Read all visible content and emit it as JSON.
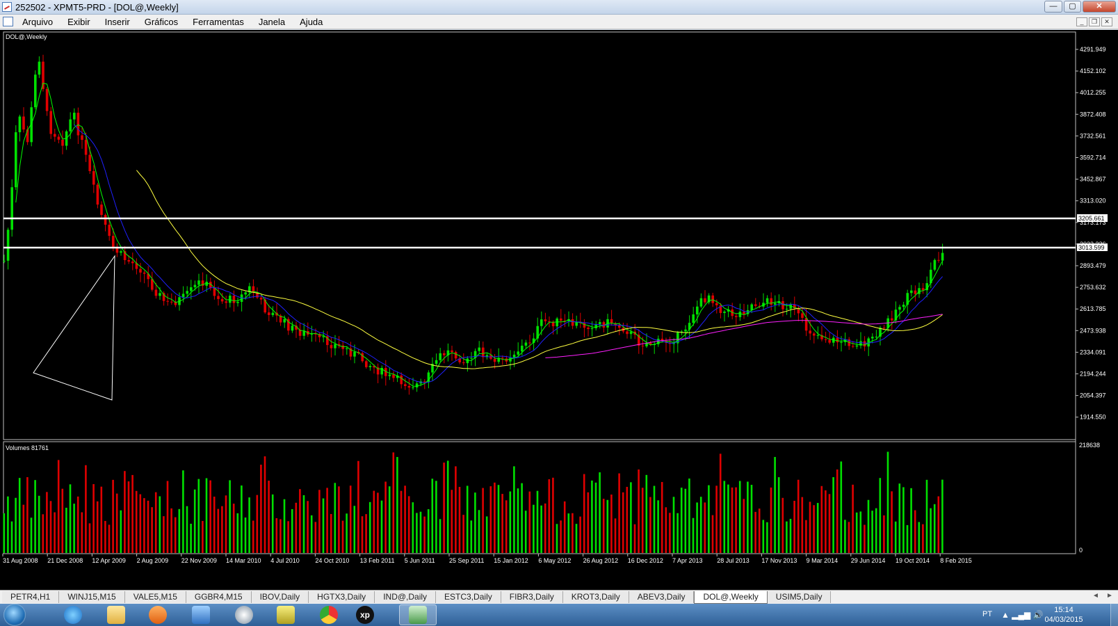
{
  "window": {
    "title": "252502 - XPMT5-PRD - [DOL@,Weekly]",
    "min_label": "—",
    "max_label": "▢",
    "close_label": "✕"
  },
  "menu": {
    "items": [
      "Arquivo",
      "Exibir",
      "Inserir",
      "Gráficos",
      "Ferramentas",
      "Janela",
      "Ajuda"
    ],
    "mdi_min": "_",
    "mdi_restore": "❐",
    "mdi_close": "✕"
  },
  "chart": {
    "symbol_label": "DOL@,Weekly",
    "volume_label": "Volumes 81761",
    "price_axis": [
      "4291.949",
      "4152.102",
      "4012.255",
      "3872.408",
      "3732.561",
      "3592.714",
      "3452.867",
      "3313.020",
      "3173.173",
      "3033.326",
      "2893.479",
      "2753.632",
      "2613.785",
      "2473.938",
      "2334.091",
      "2194.244",
      "2054.397",
      "1914.550"
    ],
    "hline_labels": [
      "3205.661",
      "3013.599"
    ],
    "volume_axis": [
      "218638",
      "0"
    ],
    "date_axis": [
      "31 Aug 2008",
      "21 Dec 2008",
      "12 Apr 2009",
      "2 Aug 2009",
      "22 Nov 2009",
      "14 Mar 2010",
      "4 Jul 2010",
      "24 Oct 2010",
      "13 Feb 2011",
      "5 Jun 2011",
      "25 Sep 2011",
      "15 Jan 2012",
      "6 May 2012",
      "26 Aug 2012",
      "16 Dec 2012",
      "7 Apr 2013",
      "28 Jul 2013",
      "17 Nov 2013",
      "9 Mar 2014",
      "29 Jun 2014",
      "19 Oct 2014",
      "8 Feb 2015"
    ],
    "colors": {
      "background": "#000000",
      "bull": "#00e000",
      "bear": "#e00000",
      "ma_fast": "#00ff00",
      "ma_mid": "#2020ff",
      "ma_slow": "#ffff40",
      "ma_long": "#ff20ff",
      "hline": "#ffffff"
    }
  },
  "tabs": {
    "items": [
      "PETR4,H1",
      "WINJ15,M15",
      "VALE5,M15",
      "GGBR4,M15",
      "IBOV,Daily",
      "HGTX3,Daily",
      "IND@,Daily",
      "ESTC3,Daily",
      "FIBR3,Daily",
      "KROT3,Daily",
      "ABEV3,Daily",
      "DOL@,Weekly",
      "USIM5,Daily"
    ],
    "active": "DOL@,Weekly",
    "scroll_left": "◄",
    "scroll_right": "►"
  },
  "taskbar": {
    "apps": [
      "windows-explorer-icon",
      "internet-explorer-icon",
      "folder-icon",
      "media-player-icon",
      "network-icon",
      "hp-icon",
      "file-manager-icon",
      "chrome-icon",
      "xp-icon",
      "metatrader-icon"
    ],
    "lang": "PT",
    "tray_icons": "▲  ▂▄▆  🔊",
    "time": "15:14",
    "date": "04/03/2015"
  }
}
